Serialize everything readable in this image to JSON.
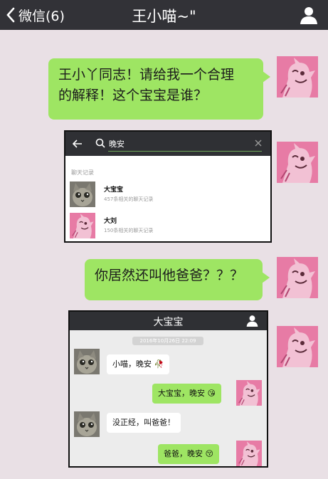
{
  "header": {
    "back_label": "微信(6)",
    "title": "王小喵~\""
  },
  "messages": {
    "m1_line1": "王小丫同志！请给我一个合理",
    "m1_line2": "的解释！这个宝宝是谁？",
    "m2": "你居然还叫他爸爸？？？"
  },
  "search_shot": {
    "query": "晚安",
    "section": "聊天记录",
    "results": [
      {
        "name": "大宝宝",
        "sub": "457条相关的聊天记录"
      },
      {
        "name": "大刘",
        "sub": "150条相关的聊天记录"
      }
    ]
  },
  "chat_shot": {
    "title": "大宝宝",
    "time": "2016年10月26日 22:09",
    "messages": [
      "小喵，晚安",
      "大宝宝，晚安",
      "没正经，叫爸爸！",
      "爸爸，晚安"
    ]
  },
  "colors": {
    "topbar": "#323237",
    "background": "#e9e0e5",
    "bubble_green": "#9ee563",
    "avatar_pink": "#e77ba5"
  },
  "icons": [
    "back-chevron-icon",
    "person-icon",
    "search-icon",
    "clear-icon",
    "rose-emoji",
    "smile-emoji",
    "blush-emoji"
  ]
}
